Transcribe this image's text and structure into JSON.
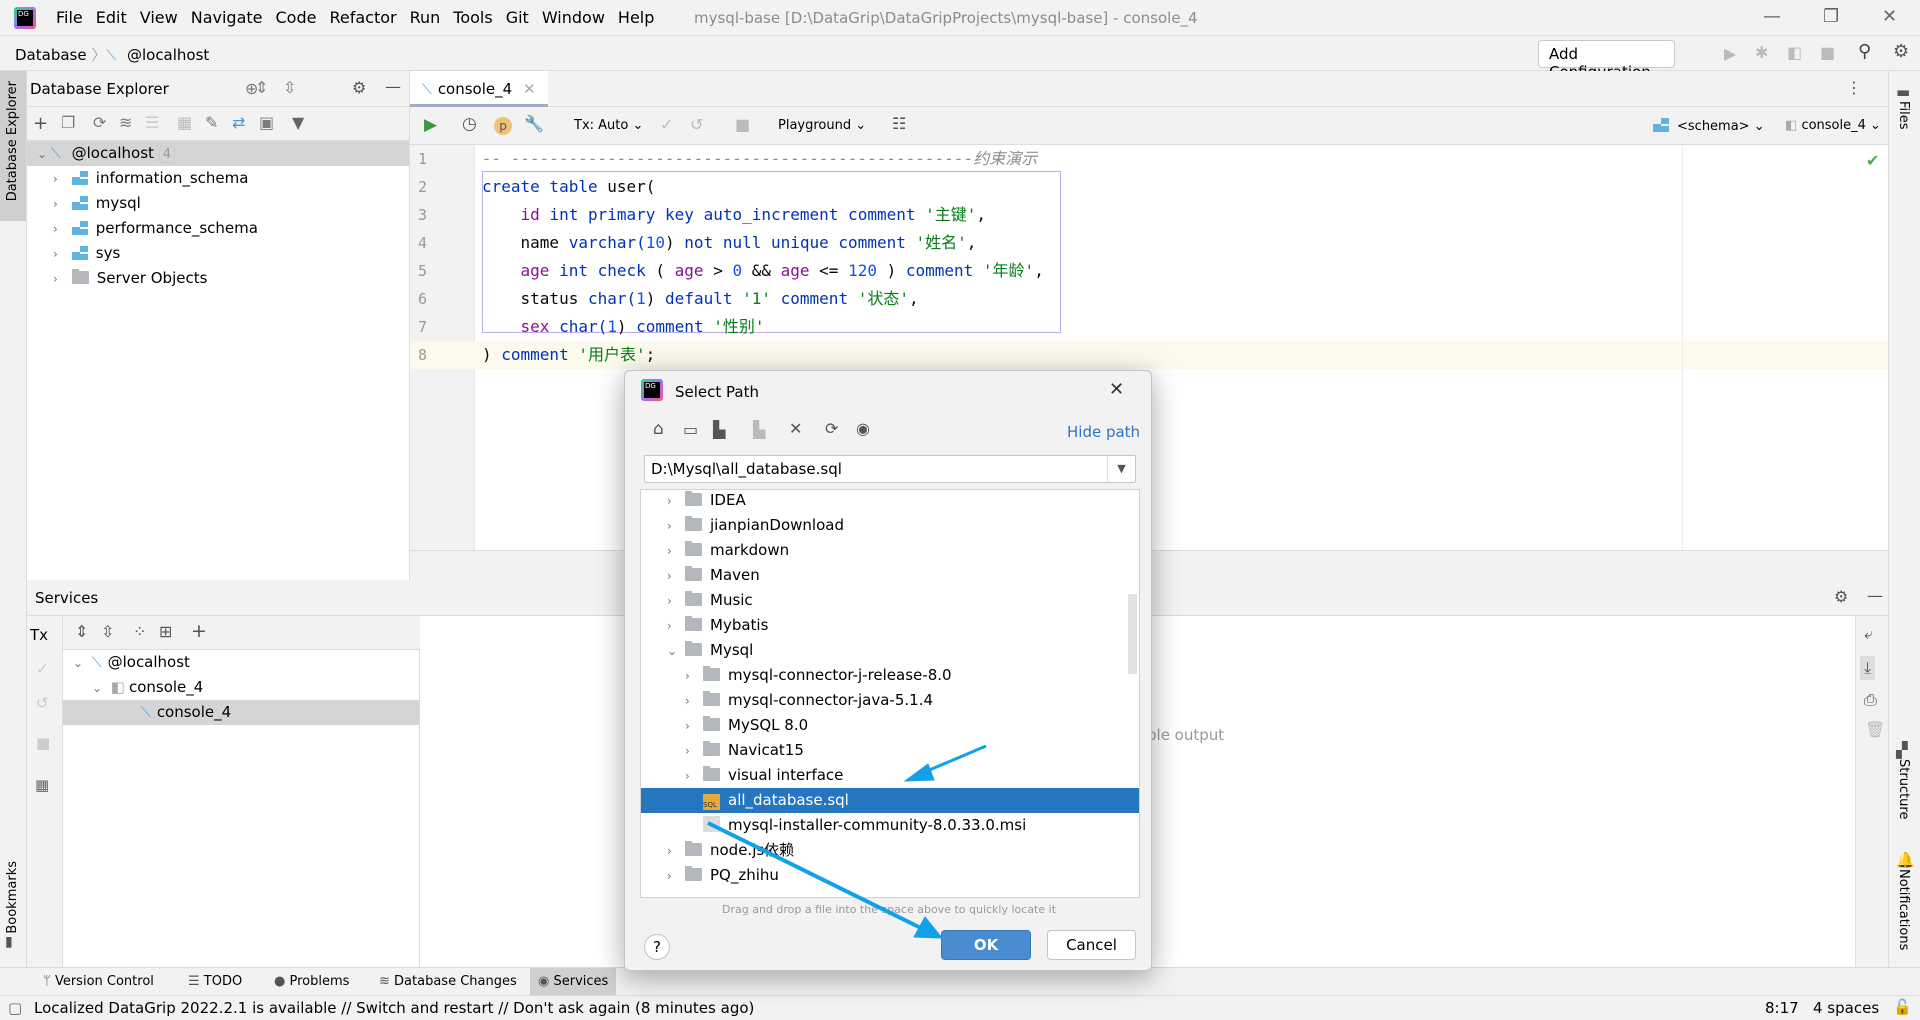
{
  "window": {
    "title": "mysql-base [D:\\DataGrip\\DataGripProjects\\mysql-base] - console_4",
    "logo_text": "DG"
  },
  "menu": [
    "File",
    "Edit",
    "View",
    "Navigate",
    "Code",
    "Refactor",
    "Run",
    "Tools",
    "Git",
    "Window",
    "Help"
  ],
  "breadcrumb": {
    "root": "Database",
    "host": "@localhost"
  },
  "toolbar": {
    "add_configuration": "Add Configuration..."
  },
  "left_stripe": {
    "database_explorer": "Database Explorer",
    "bookmarks": "Bookmarks"
  },
  "right_stripe": {
    "files": "Files",
    "structure": "Structure",
    "notifications": "Notifications"
  },
  "db_explorer": {
    "title": "Database Explorer",
    "host": {
      "label": "@localhost",
      "count": "4"
    },
    "items": [
      {
        "label": "information_schema",
        "icon": "schema-icon"
      },
      {
        "label": "mysql",
        "icon": "schema-icon"
      },
      {
        "label": "performance_schema",
        "icon": "schema-icon"
      },
      {
        "label": "sys",
        "icon": "schema-icon"
      },
      {
        "label": "Server Objects",
        "icon": "server-objects-icon"
      }
    ]
  },
  "editor": {
    "tab": "console_4",
    "tx_mode": "Tx: Auto",
    "playground": "Playground",
    "schema_selector": "<schema>",
    "session_selector": "console_4",
    "lines": [
      [
        [
          "-- ------------------------------------------------约束演示",
          "cmt"
        ]
      ],
      [
        [
          "create table ",
          "kw"
        ],
        [
          "user(",
          "pl"
        ]
      ],
      [
        [
          "    ",
          "pl"
        ],
        [
          "id ",
          "col"
        ],
        [
          "int primary key auto_increment comment ",
          "kw"
        ],
        [
          "'主键'",
          "str"
        ],
        [
          ",",
          "pl"
        ]
      ],
      [
        [
          "    name ",
          "pl"
        ],
        [
          "varchar(",
          "kw"
        ],
        [
          "10",
          "num"
        ],
        [
          ") ",
          "pl"
        ],
        [
          "not null unique comment ",
          "kw"
        ],
        [
          "'姓名'",
          "str"
        ],
        [
          ",",
          "pl"
        ]
      ],
      [
        [
          "    ",
          "pl"
        ],
        [
          "age ",
          "col"
        ],
        [
          "int check ",
          "kw"
        ],
        [
          "( ",
          "pl"
        ],
        [
          "age ",
          "col"
        ],
        [
          "> ",
          "pl"
        ],
        [
          "0 ",
          "num"
        ],
        [
          "&& ",
          "pl"
        ],
        [
          "age ",
          "col"
        ],
        [
          "<= ",
          "pl"
        ],
        [
          "120 ",
          "num"
        ],
        [
          ") ",
          "pl"
        ],
        [
          "comment ",
          "kw"
        ],
        [
          "'年龄'",
          "str"
        ],
        [
          ",",
          "pl"
        ]
      ],
      [
        [
          "    status ",
          "pl"
        ],
        [
          "char(",
          "kw"
        ],
        [
          "1",
          "num"
        ],
        [
          ") ",
          "pl"
        ],
        [
          "default ",
          "kw"
        ],
        [
          "'1' ",
          "str"
        ],
        [
          "comment ",
          "kw"
        ],
        [
          "'状态'",
          "str"
        ],
        [
          ",",
          "pl"
        ]
      ],
      [
        [
          "    ",
          "pl"
        ],
        [
          "sex ",
          "col"
        ],
        [
          "char(",
          "kw"
        ],
        [
          "1",
          "num"
        ],
        [
          ") ",
          "pl"
        ],
        [
          "comment ",
          "kw"
        ],
        [
          "'性别'",
          "str"
        ]
      ],
      [
        [
          ") ",
          "pl"
        ],
        [
          "comment ",
          "kw"
        ],
        [
          "'用户表'",
          "str"
        ],
        [
          ";",
          "pl"
        ]
      ]
    ]
  },
  "services": {
    "title": "Services",
    "tx": "Tx",
    "tree": [
      {
        "label": "@localhost"
      },
      {
        "label": "console_4"
      },
      {
        "label": "console_4"
      }
    ],
    "output_fragment": "ble output"
  },
  "bottom_tabs": [
    "Version Control",
    "TODO",
    "Problems",
    "Database Changes",
    "Services"
  ],
  "status": {
    "message": "Localized DataGrip 2022.2.1 is available // Switch and restart // Don't ask again (8 minutes ago)",
    "position": "8:17",
    "indent": "4 spaces"
  },
  "dialog": {
    "title": "Select Path",
    "hide_path": "Hide path",
    "path_value": "D:\\Mysql\\all_database.sql",
    "tree": [
      {
        "label": "IDEA",
        "level": 0,
        "type": "folder",
        "expanded": false
      },
      {
        "label": "jianpianDownload",
        "level": 0,
        "type": "folder",
        "expanded": false
      },
      {
        "label": "markdown",
        "level": 0,
        "type": "folder",
        "expanded": false
      },
      {
        "label": "Maven",
        "level": 0,
        "type": "folder",
        "expanded": false
      },
      {
        "label": "Music",
        "level": 0,
        "type": "folder",
        "expanded": false
      },
      {
        "label": "Mybatis",
        "level": 0,
        "type": "folder",
        "expanded": false
      },
      {
        "label": "Mysql",
        "level": 0,
        "type": "folder",
        "expanded": true
      },
      {
        "label": "mysql-connector-j-release-8.0",
        "level": 1,
        "type": "folder",
        "expanded": false
      },
      {
        "label": "mysql-connector-java-5.1.4",
        "level": 1,
        "type": "folder",
        "expanded": false
      },
      {
        "label": "MySQL 8.0",
        "level": 1,
        "type": "folder",
        "expanded": false
      },
      {
        "label": "Navicat15",
        "level": 1,
        "type": "folder",
        "expanded": false
      },
      {
        "label": "visual interface",
        "level": 1,
        "type": "folder",
        "expanded": false
      },
      {
        "label": "all_database.sql",
        "level": 1,
        "type": "sql",
        "selected": true
      },
      {
        "label": "mysql-installer-community-8.0.33.0.msi",
        "level": 1,
        "type": "msi"
      },
      {
        "label": "node.js依赖",
        "level": 0,
        "type": "folder",
        "expanded": false
      },
      {
        "label": "PQ_zhihu",
        "level": 0,
        "type": "folder",
        "expanded": false
      }
    ],
    "hint": "Drag and drop a file into the space above to quickly locate it",
    "ok": "OK",
    "cancel": "Cancel",
    "help": "?"
  },
  "colors": {
    "accent": "#2675bf",
    "annotation_arrow": "#12a0e8",
    "selection": "#2675bf",
    "ok_button": "#4a8cd0"
  }
}
